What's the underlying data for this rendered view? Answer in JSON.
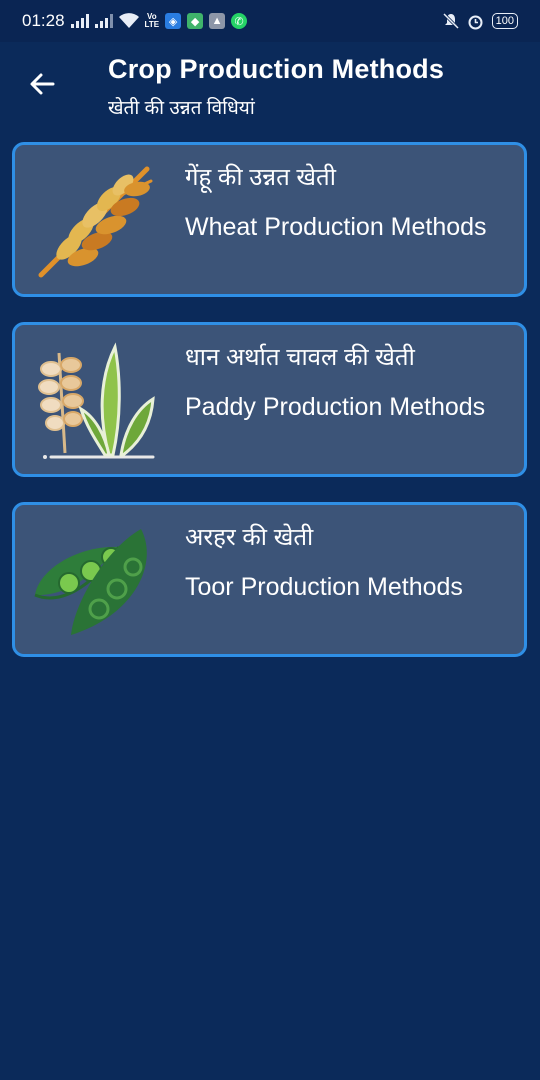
{
  "status_bar": {
    "time": "01:28",
    "volte": "VoLTE",
    "battery": "100"
  },
  "header": {
    "title": "Crop Production Methods",
    "subtitle": "खेती की उन्नत विधियां"
  },
  "crops": [
    {
      "hindi": "गेंहू की उन्नत खेती",
      "english": "Wheat Production Methods",
      "icon": "wheat-icon"
    },
    {
      "hindi": "धान अर्थात चावल की खेती",
      "english": "Paddy Production Methods",
      "icon": "paddy-icon"
    },
    {
      "hindi": "अरहर की खेती",
      "english": "Toor Production Methods",
      "icon": "pea-pod-icon"
    }
  ],
  "colors": {
    "background": "#0b2a5a",
    "card": "#3c5478",
    "card_border": "#2f8fe6"
  }
}
